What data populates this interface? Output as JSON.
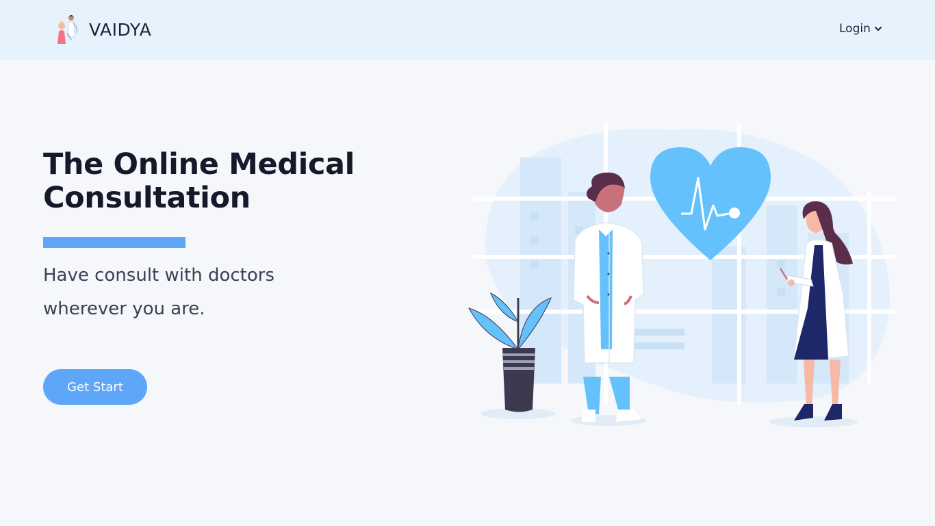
{
  "nav": {
    "brand": "VAIDYA",
    "login_label": "Login"
  },
  "hero": {
    "title": "The Online Medical Consultation",
    "subtitle": "Have consult with doctors wherever you are.",
    "cta_label": "Get Start"
  },
  "colors": {
    "accent": "#5ea7f8",
    "navbar_bg": "#e6f3fd",
    "page_bg": "#f5f7fb",
    "heart": "#64c1fb"
  },
  "icons": {
    "brand_logo": "doctor-logo-icon",
    "login_chevron": "chevron-down-icon",
    "illustration": "doctors-illustration"
  }
}
